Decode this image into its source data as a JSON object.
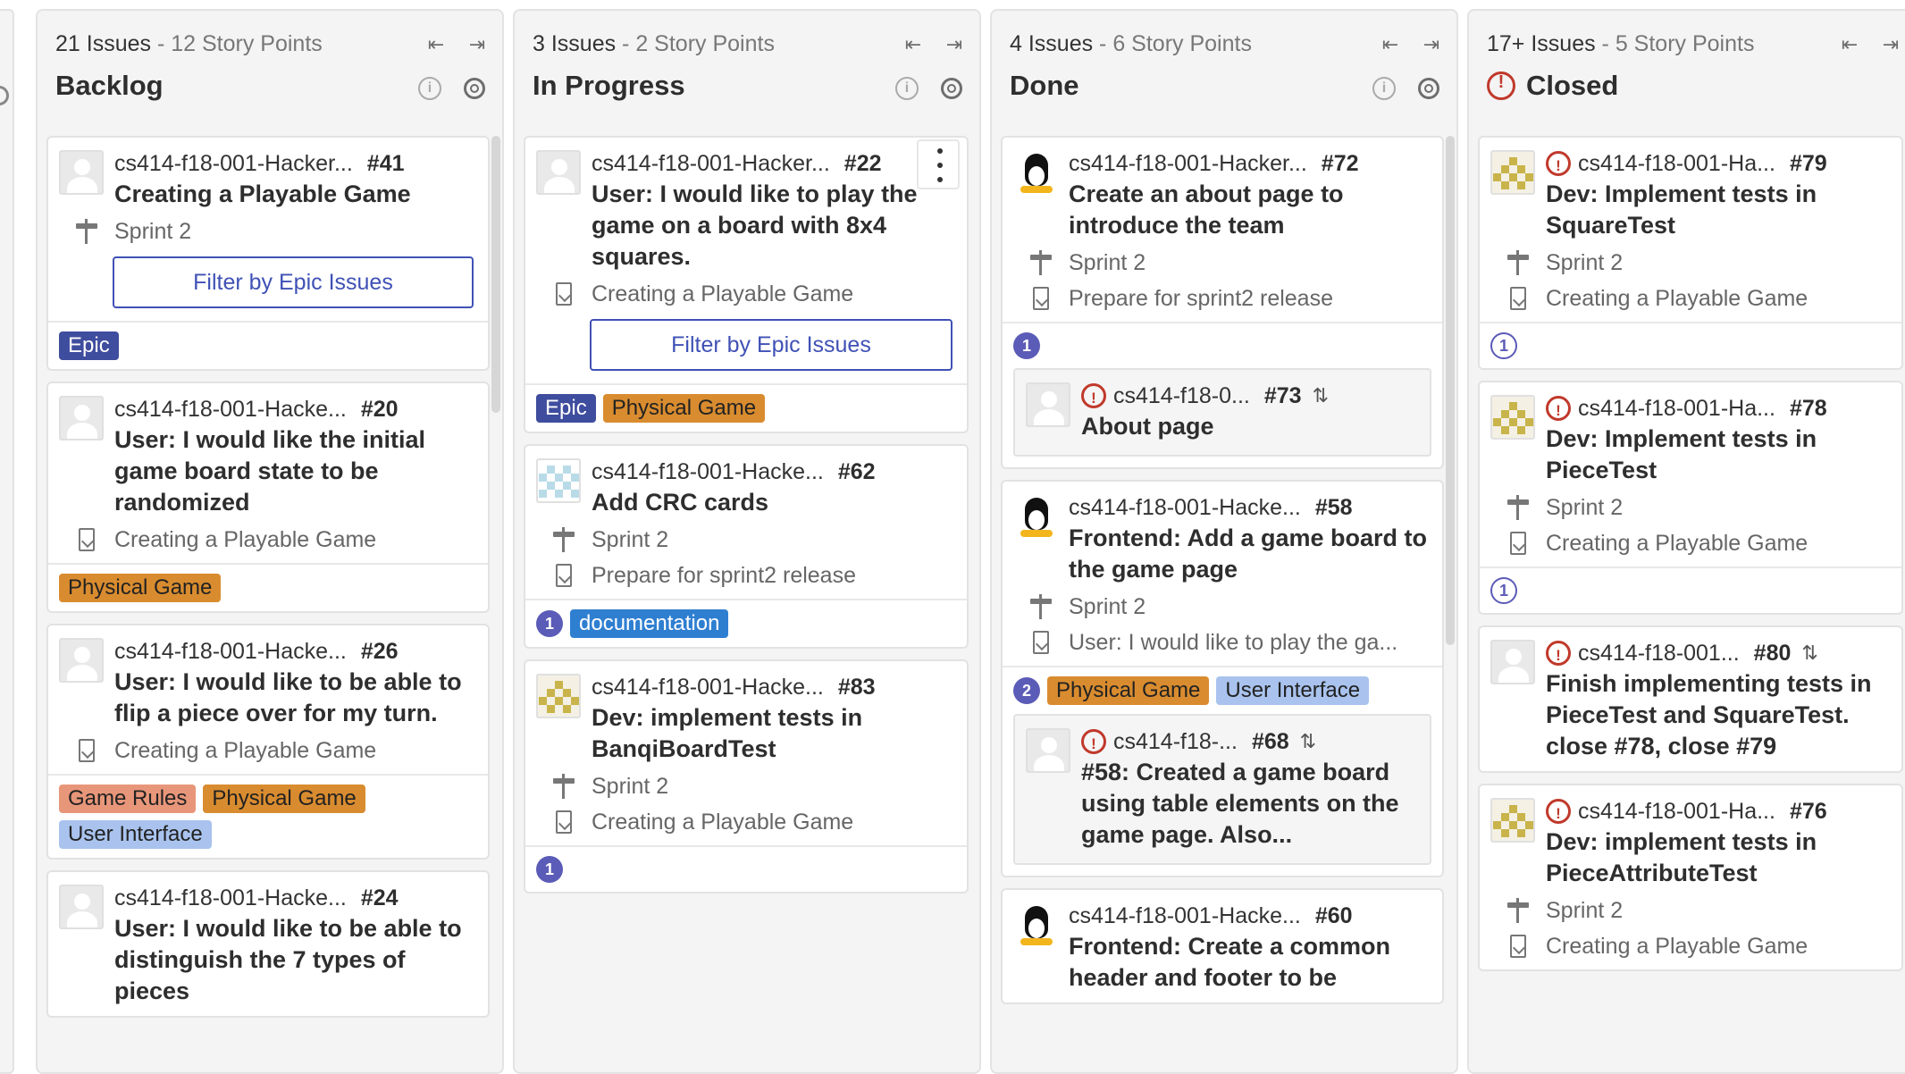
{
  "columns": [
    {
      "meta_count": "21 Issues",
      "meta_points": " - 12 Story Points",
      "title": "Backlog",
      "cards": [
        {
          "project": "cs414-f18-001-Hacker...",
          "number": "#41",
          "title": "Creating a Playable Game",
          "milestone": "Sprint 2",
          "button": "Filter by Epic Issues",
          "labels": [
            {
              "text": "Epic"
            }
          ]
        },
        {
          "project": "cs414-f18-001-Hacke...",
          "number": "#20",
          "title": "User: I would like the initial game board state to be randomized",
          "epic": "Creating a Playable Game",
          "labels": [
            {
              "text": "Physical Game"
            }
          ]
        },
        {
          "project": "cs414-f18-001-Hacke...",
          "number": "#26",
          "title": "User: I would like to be able to flip a piece over for my turn.",
          "epic": "Creating a Playable Game",
          "labels": [
            {
              "text": "Game Rules"
            },
            {
              "text": "Physical Game"
            },
            {
              "text": "User Interface"
            }
          ]
        },
        {
          "project": "cs414-f18-001-Hacke...",
          "number": "#24",
          "title": "User: I would like to be able to distinguish the 7 types of pieces"
        }
      ]
    },
    {
      "meta_count": "3 Issues",
      "meta_points": " - 2 Story Points",
      "title": "In Progress",
      "cards": [
        {
          "project": "cs414-f18-001-Hacker...",
          "number": "#22",
          "title": "User: I would like to play the game on a board with 8x4 squares.",
          "epic": "Creating a Playable Game",
          "button": "Filter by Epic Issues",
          "labels": [
            {
              "text": "Epic"
            },
            {
              "text": "Physical Game"
            }
          ]
        },
        {
          "project": "cs414-f18-001-Hacke...",
          "number": "#62",
          "title": "Add CRC cards",
          "milestone": "Sprint 2",
          "epic": "Prepare for sprint2 release",
          "weight": "1",
          "labels": [
            {
              "text": "documentation"
            }
          ]
        },
        {
          "project": "cs414-f18-001-Hacke...",
          "number": "#83",
          "title": "Dev: implement tests in BanqiBoardTest",
          "milestone": "Sprint 2",
          "epic": "Creating a Playable Game",
          "weight": "1"
        }
      ]
    },
    {
      "meta_count": "4 Issues",
      "meta_points": " - 6 Story Points",
      "title": "Done",
      "cards": [
        {
          "project": "cs414-f18-001-Hacker...",
          "number": "#72",
          "title": "Create an about page to introduce the team",
          "milestone": "Sprint 2",
          "epic": "Prepare for sprint2 release",
          "weight": "1",
          "child": {
            "project": "cs414-f18-0...",
            "number": "#73",
            "title": "About page"
          }
        },
        {
          "project": "cs414-f18-001-Hacke...",
          "number": "#58",
          "title": "Frontend: Add a game board to the game page",
          "milestone": "Sprint 2",
          "epic": "User: I would like to play the ga...",
          "weight": "2",
          "labels": [
            {
              "text": "Physical Game"
            },
            {
              "text": "User Interface"
            }
          ],
          "child": {
            "project": "cs414-f18-...",
            "number": "#68",
            "title": "#58: Created a game board using table elements on the game page. Also..."
          }
        },
        {
          "project": "cs414-f18-001-Hacke...",
          "number": "#60",
          "title": "Frontend: Create a common header and footer to be"
        }
      ]
    },
    {
      "meta_count": "17+ Issues",
      "meta_points": " - 5 Story Points",
      "title": "Closed",
      "cards": [
        {
          "project": "cs414-f18-001-Ha...",
          "number": "#79",
          "title": "Dev: Implement tests in SquareTest",
          "milestone": "Sprint 2",
          "epic": "Creating a Playable Game",
          "weight": "1"
        },
        {
          "project": "cs414-f18-001-Ha...",
          "number": "#78",
          "title": "Dev: Implement tests in PieceTest",
          "milestone": "Sprint 2",
          "epic": "Creating a Playable Game",
          "weight": "1"
        },
        {
          "project": "cs414-f18-001...",
          "number": "#80",
          "title": "Finish implementing tests in PieceTest and SquareTest. close #78, close #79"
        },
        {
          "project": "cs414-f18-001-Ha...",
          "number": "#76",
          "title": "Dev: implement tests in PieceAttributeTest",
          "milestone": "Sprint 2",
          "epic": "Creating a Playable Game"
        }
      ]
    }
  ],
  "colors": {
    "epic_label": "#3f4d9e",
    "physical_game_label": "#d98c2f",
    "game_rules_label": "#e8967a",
    "user_interface_label": "#a9c3ee",
    "documentation_label": "#2f7fd1",
    "weight_badge": "#5b5bb8",
    "closed_icon": "#c0392b",
    "filter_button": "#3f51b5"
  }
}
